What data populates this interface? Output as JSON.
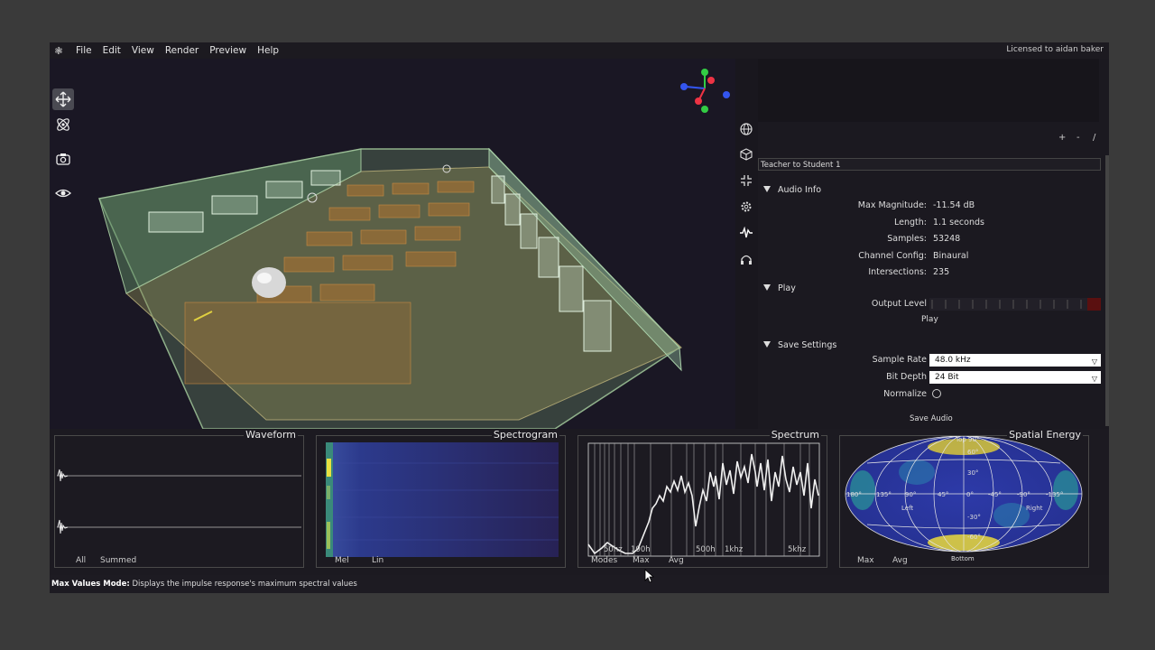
{
  "menubar": {
    "items": [
      "File",
      "Edit",
      "View",
      "Render",
      "Preview",
      "Help"
    ],
    "license": "Licensed to aidan baker"
  },
  "toolbar": {
    "tools": [
      "move-icon",
      "atom-icon",
      "camera-icon",
      "eye-icon"
    ]
  },
  "side_icons": [
    "globe-icon",
    "cube-icon",
    "compress-icon",
    "gear-icon",
    "waveform-icon",
    "headphones-icon"
  ],
  "panel": {
    "buttons": [
      "+",
      "-",
      "/"
    ],
    "simulation_name": "Teacher to Student 1",
    "audio_info": {
      "title": "Audio Info",
      "rows": [
        {
          "key": "Max Magnitude:",
          "value": "-11.54 dB"
        },
        {
          "key": "Length:",
          "value": "1.1 seconds"
        },
        {
          "key": "Samples:",
          "value": "53248"
        },
        {
          "key": "Channel Config:",
          "value": "Binaural"
        },
        {
          "key": "Intersections:",
          "value": "235"
        }
      ]
    },
    "play": {
      "title": "Play",
      "output_level_label": "Output Level",
      "output_level": 0.08,
      "play_label": "Play"
    },
    "save_settings": {
      "title": "Save Settings",
      "sample_rate_label": "Sample Rate",
      "sample_rate": "48.0 kHz",
      "bit_depth_label": "Bit Depth",
      "bit_depth": "24 Bit",
      "normalize_label": "Normalize",
      "normalize": false,
      "save_label": "Save Audio"
    }
  },
  "plots": {
    "waveform": {
      "title": "Waveform",
      "tabs": [
        "All",
        "Summed"
      ]
    },
    "spectrogram": {
      "title": "Spectrogram",
      "tabs": [
        "Mel",
        "Lin"
      ]
    },
    "spectrum": {
      "title": "Spectrum",
      "tabs": [
        "Modes",
        "Max",
        "Avg"
      ],
      "freq_labels": [
        "50hz",
        "100h",
        "500h",
        "1khz",
        "5khz"
      ]
    },
    "spatial_energy": {
      "title": "Spatial Energy",
      "tabs": [
        "Max",
        "Avg"
      ],
      "top_label": "Top 90°",
      "bottom_label": "Bottom",
      "left_label": "Left",
      "right_label": "Right",
      "lon_labels": [
        "180°",
        "135°",
        "90°",
        "45°",
        "0°",
        "-45°",
        "-90°",
        "-135°"
      ],
      "lat_labels": [
        "60°",
        "30°",
        "-30°",
        "-60°"
      ]
    }
  },
  "status": {
    "mode_label": "Max Values Mode:",
    "description": "Displays the impulse response's maximum spectral values"
  }
}
